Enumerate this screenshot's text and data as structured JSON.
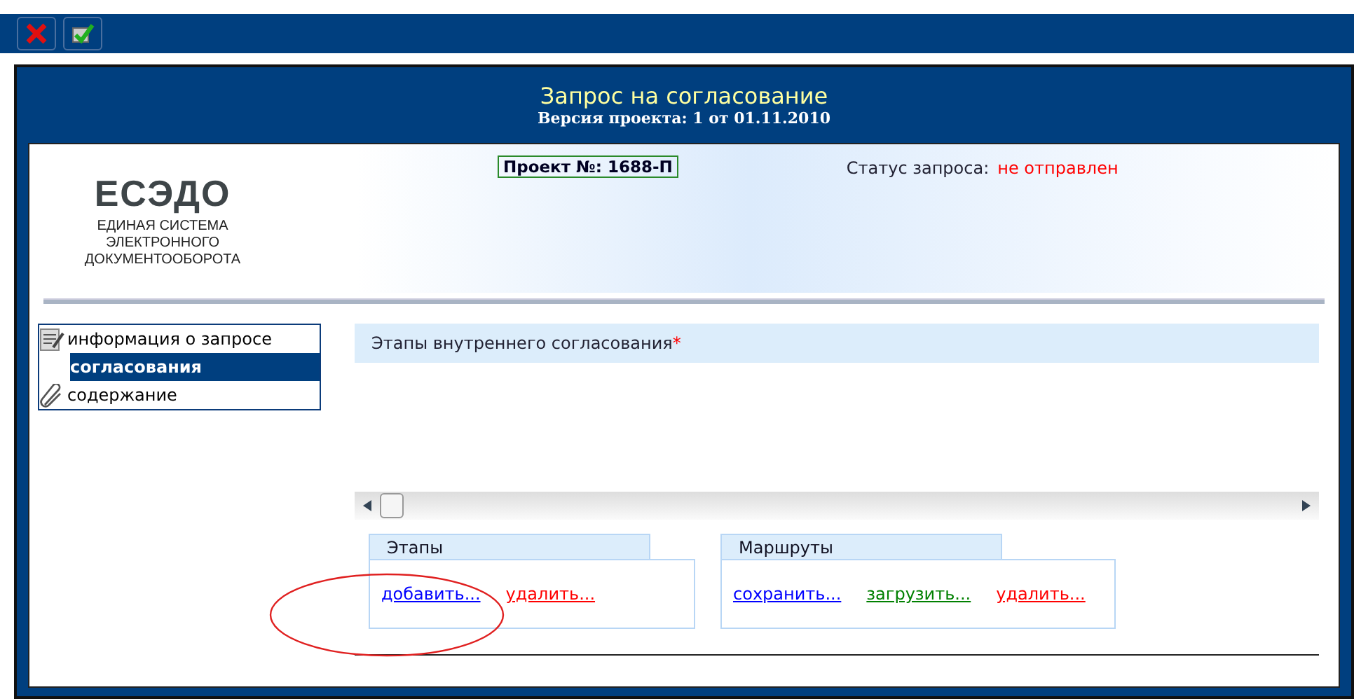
{
  "toolbar": {
    "buttons": [
      {
        "kind": "cancel"
      },
      {
        "kind": "confirm"
      }
    ]
  },
  "header": {
    "title": "Запрос на согласование",
    "version": "Версия проекта: 1 от 01.11.2010"
  },
  "logo": {
    "name": "ЕСЭДО",
    "subtitle": "ЕДИНАЯ СИСТЕМА ЭЛЕКТРОННОГО ДОКУМЕНТООБОРОТА"
  },
  "project": {
    "number": "Проект №: 1688-П"
  },
  "status": {
    "label": "Статус запроса:",
    "value": "не отправлен"
  },
  "sidebar": {
    "items": [
      {
        "label": "информация о запросе",
        "selected": false,
        "kind": "note"
      },
      {
        "label": "согласования",
        "selected": true,
        "kind": "plain"
      },
      {
        "label": "содержание",
        "selected": false,
        "kind": "attachment"
      }
    ]
  },
  "section": {
    "title": "Этапы внутреннего согласования",
    "required_mark": "*"
  },
  "panels": [
    {
      "title": "Этапы",
      "links": [
        {
          "label": "добавить...",
          "color": "#0000ff"
        },
        {
          "label": "удалить...",
          "color": "#ff0000"
        }
      ]
    },
    {
      "title": "Маршруты",
      "links": [
        {
          "label": "сохранить...",
          "color": "#0000ff"
        },
        {
          "label": "загрузить...",
          "color": "#008000"
        },
        {
          "label": "удалить...",
          "color": "#ff0000"
        }
      ]
    }
  ]
}
